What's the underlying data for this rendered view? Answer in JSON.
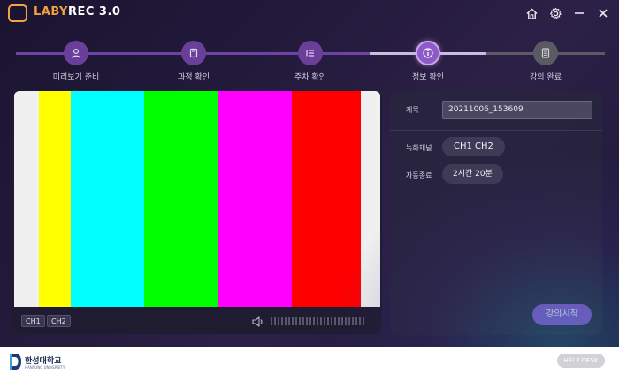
{
  "app": {
    "title_prefix": "LABY",
    "title_rest": "REC 3.0"
  },
  "titlebar": {
    "icons": [
      "home-icon",
      "gear-icon",
      "minimize-icon",
      "close-icon"
    ]
  },
  "stepper": {
    "steps": [
      {
        "label": "미리보기 준비",
        "state": "done",
        "icon": "user-icon"
      },
      {
        "label": "과정 확인",
        "state": "done",
        "icon": "book-icon"
      },
      {
        "label": "주차 확인",
        "state": "done",
        "icon": "list-icon"
      },
      {
        "label": "정보 확인",
        "state": "active",
        "icon": "info-icon"
      },
      {
        "label": "강의 완료",
        "state": "pending",
        "icon": "document-icon"
      }
    ]
  },
  "video": {
    "ch1_label": "CH1",
    "ch2_label": "CH2",
    "color_bars": [
      "#f0f0f0",
      "#ffff00",
      "#00ffff",
      "#00ff00",
      "#ff00ff",
      "#ff0000",
      "#f0f0f0"
    ]
  },
  "info": {
    "title_label": "제목",
    "title_value": "20211006_153609",
    "channel_label": "녹화채널",
    "channel_value": "CH1  CH2",
    "auto_end_label": "자동종료",
    "auto_end_value": "2시간 20분",
    "start_button": "강의시작"
  },
  "footer": {
    "university_name": "한성대학교",
    "university_sub": "HANSUNG UNIVERSITY",
    "help_button": "HELP DESK"
  },
  "colors": {
    "accent": "#8c55d8",
    "brand_orange": "#f0a040",
    "background": "#1f1a36"
  }
}
